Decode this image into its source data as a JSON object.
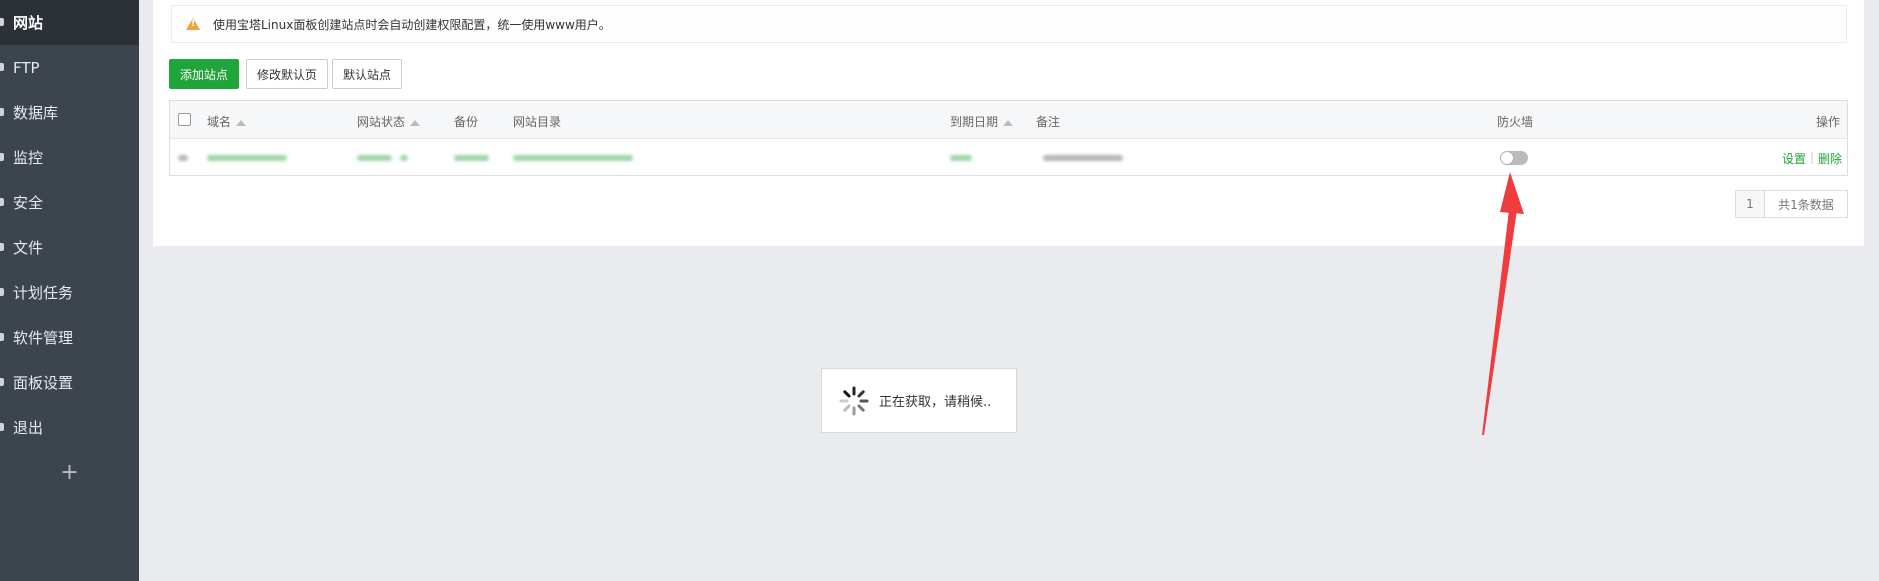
{
  "sidebar": {
    "items": [
      {
        "label": "网站",
        "active": true
      },
      {
        "label": "FTP"
      },
      {
        "label": "数据库"
      },
      {
        "label": "监控"
      },
      {
        "label": "安全"
      },
      {
        "label": "文件"
      },
      {
        "label": "计划任务"
      },
      {
        "label": "软件管理"
      },
      {
        "label": "面板设置"
      },
      {
        "label": "退出"
      }
    ],
    "add_label": "+"
  },
  "alert": {
    "text": "使用宝塔Linux面板创建站点时会自动创建权限配置，统一使用www用户。",
    "icon": "warning-icon"
  },
  "toolbar": {
    "add_site": "添加站点",
    "modify_default_page": "修改默认页",
    "default_site": "默认站点"
  },
  "table": {
    "headers": {
      "domain": "域名",
      "status": "网站状态",
      "backup": "备份",
      "directory": "网站目录",
      "expire": "到期日期",
      "remark": "备注",
      "firewall": "防火墙",
      "actions": "操作"
    },
    "rows": [
      {
        "firewall_enabled": false,
        "actions": {
          "settings": "设置",
          "separator": "|",
          "delete": "删除"
        }
      }
    ]
  },
  "pagination": {
    "page": "1",
    "total": "共1条数据"
  },
  "loading": {
    "text": "正在获取，请稍候.."
  },
  "colors": {
    "accent": "#20a53a",
    "sidebar": "#3c444d",
    "annotation": "#f03c3c"
  }
}
